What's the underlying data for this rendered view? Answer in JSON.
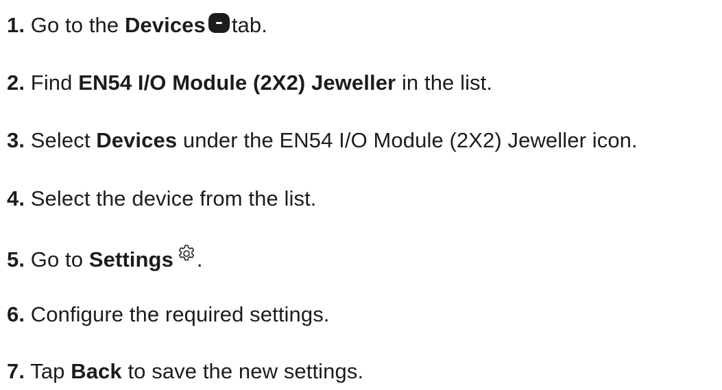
{
  "steps": [
    {
      "num": "1.",
      "t1": "Go to the",
      "b1": "Devices",
      "t2": "tab."
    },
    {
      "num": "2.",
      "t1": "Find",
      "b1": "EN54 I/O Module (2X2) Jeweller",
      "t2": "in the list."
    },
    {
      "num": "3.",
      "t1": "Select",
      "b1": "Devices",
      "t2": "under the EN54 I/O Module (2X2) Jeweller icon."
    },
    {
      "num": "4.",
      "t1": "Select the device from the list."
    },
    {
      "num": "5.",
      "t1": "Go to",
      "b1": "Settings",
      "t2": "."
    },
    {
      "num": "6.",
      "t1": "Configure the required settings."
    },
    {
      "num": "7.",
      "t1": "Tap",
      "b1": "Back",
      "t2": "to save the new settings."
    }
  ],
  "icons": {
    "devices_tab": "devices-tab-icon",
    "settings": "gear-icon"
  },
  "colors": {
    "text": "#1c1c1c",
    "background": "#ffffff"
  }
}
